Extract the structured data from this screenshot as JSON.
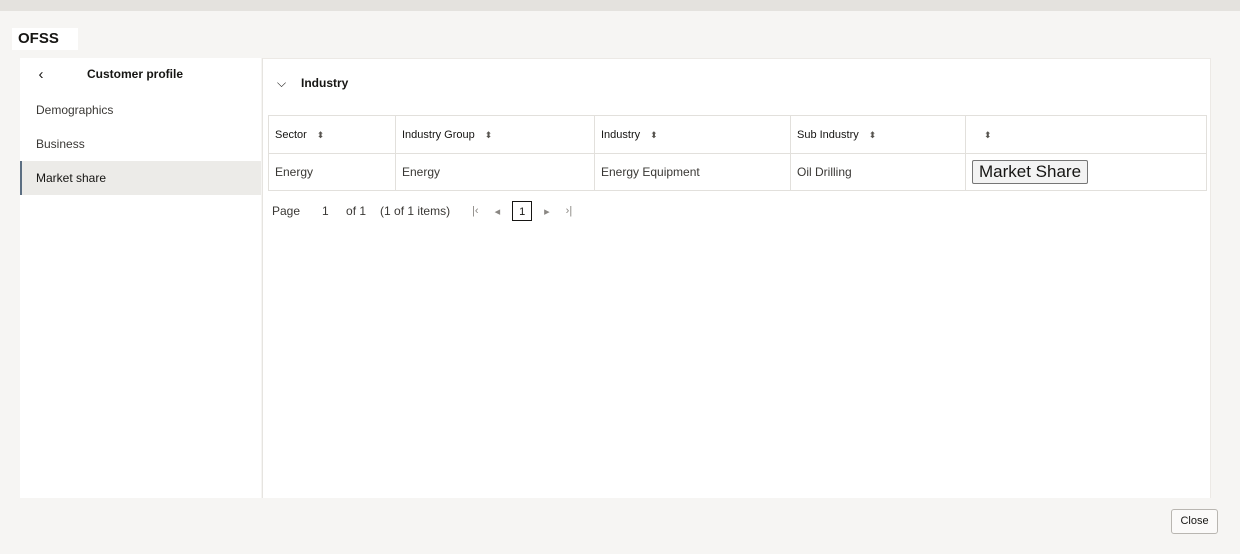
{
  "app": {
    "logo_text": "OFSS"
  },
  "sidebar": {
    "title": "Customer profile",
    "back_icon": "chevron-left-icon",
    "items": [
      {
        "label": "Demographics",
        "active": false
      },
      {
        "label": "Business",
        "active": false
      },
      {
        "label": "Market share",
        "active": true
      }
    ]
  },
  "section": {
    "title": "Industry",
    "expanded": true,
    "toggle_icon": "chevron-down-icon"
  },
  "table": {
    "headers": [
      "Sector",
      "Industry Group",
      "Industry",
      "Sub Industry",
      ""
    ],
    "rows": [
      {
        "sector": "Energy",
        "industry_group": "Energy",
        "industry": "Energy Equipment",
        "sub_industry": "Oil Drilling",
        "action_label": "Market Share"
      }
    ]
  },
  "pagination": {
    "page_label": "Page",
    "current_page": "1",
    "of_label": "of 1",
    "items_label": "(1 of 1 items)",
    "page_button": "1"
  },
  "footer": {
    "close_label": "Close"
  },
  "colors": {
    "active_indicator": "#5b6e82",
    "background": "#f6f5f3"
  }
}
